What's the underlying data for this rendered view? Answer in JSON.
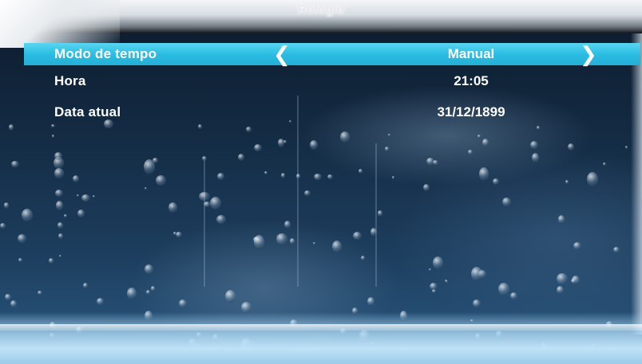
{
  "header": {
    "title": "Relógio"
  },
  "menu": {
    "rows": [
      {
        "label": "Modo de tempo",
        "value": "Manual",
        "selected": true
      },
      {
        "label": "Hora",
        "value": "21:05",
        "selected": false
      },
      {
        "label": "Data atual",
        "value": "31/12/1899",
        "selected": false
      }
    ]
  },
  "icons": {
    "left_arrow": "chevron-left-icon",
    "right_arrow": "chevron-right-icon"
  },
  "colors": {
    "highlight": "#2bbde3",
    "text": "#ffffff",
    "background": "#132a42"
  }
}
